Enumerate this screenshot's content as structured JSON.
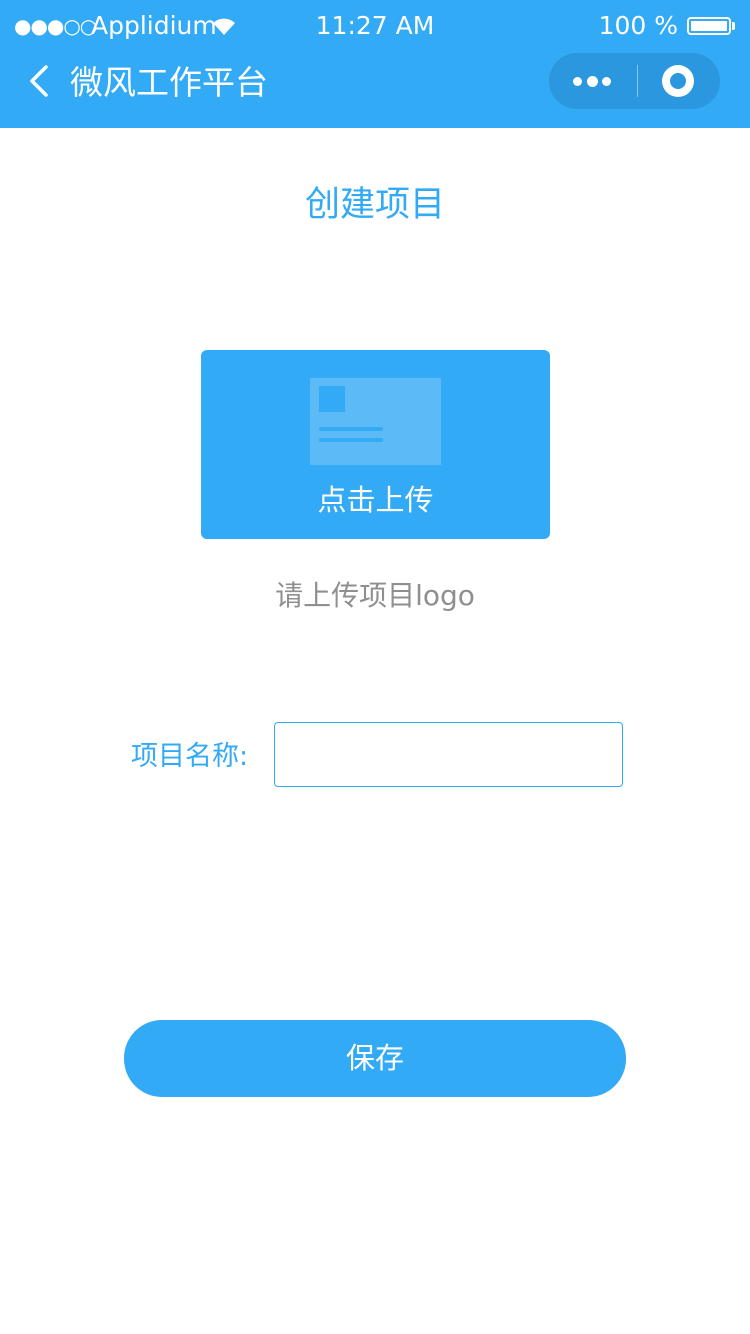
{
  "status_bar": {
    "signal": "●●●○○",
    "carrier": "Applidium",
    "time": "11:27 AM",
    "battery_percent": "100 %"
  },
  "nav": {
    "back_icon": "chevron-left-icon",
    "title": "微风工作平台",
    "more_icon": "more-dots-icon",
    "close_icon": "target-circle-icon"
  },
  "page": {
    "title": "创建项目"
  },
  "upload": {
    "icon": "id-card-image-icon",
    "label": "点击上传",
    "hint": "请上传项目logo"
  },
  "form": {
    "name_label": "项目名称:",
    "name_value": "",
    "name_placeholder": ""
  },
  "actions": {
    "save_label": "保存"
  },
  "colors": {
    "primary": "#33aaf5",
    "capsule": "#2a97df",
    "hint_text": "#8f8f8f"
  }
}
